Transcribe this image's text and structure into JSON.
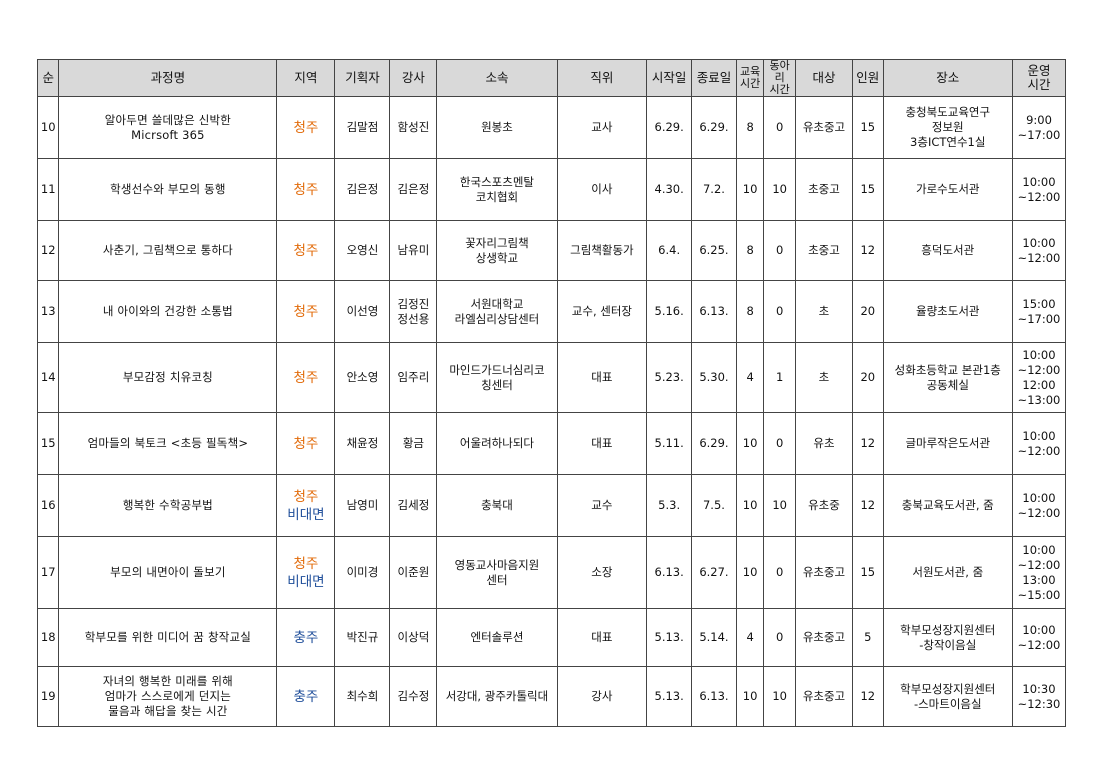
{
  "headers": {
    "no": "순",
    "course": "과정명",
    "region": "지역",
    "planner": "기획자",
    "instructor": "강사",
    "affiliation": "소속",
    "position": "직위",
    "start": "시작일",
    "end": "종료일",
    "edu_hours": "교육\n시간",
    "club_hours": "동아리\n시간",
    "target": "대상",
    "count": "인원",
    "place": "장소",
    "op_time": "운영\n시간"
  },
  "colors": {
    "cheongju": "#e26b0a",
    "online": "#1f4e9a",
    "chungju": "#1f4e9a",
    "header_bg": "#d9d9d9"
  },
  "rows": [
    {
      "no": "10",
      "course": [
        "알아두면 쓸데많은 신박한",
        "Micrsoft 365"
      ],
      "region": [
        "청주"
      ],
      "region_colors": [
        "orange"
      ],
      "planner": [
        "김말점"
      ],
      "instructor": [
        "함성진"
      ],
      "affiliation": [
        "원봉초"
      ],
      "position": [
        "교사"
      ],
      "start": "6.29.",
      "end": "6.29.",
      "edu": "8",
      "club": "0",
      "target": "유초중고",
      "count": "15",
      "place": [
        "충청북도교육연구",
        "정보원",
        "3층ICT연수1실"
      ],
      "time": [
        "9:00",
        "~17:00"
      ]
    },
    {
      "no": "11",
      "course": [
        "학생선수와 부모의 동행"
      ],
      "region": [
        "청주"
      ],
      "region_colors": [
        "orange"
      ],
      "planner": [
        "김은정"
      ],
      "instructor": [
        "김은정"
      ],
      "affiliation": [
        "한국스포츠멘탈",
        "코치협회"
      ],
      "position": [
        "이사"
      ],
      "start": "4.30.",
      "end": "7.2.",
      "edu": "10",
      "club": "10",
      "target": "초중고",
      "count": "15",
      "place": [
        "가로수도서관"
      ],
      "time": [
        "10:00",
        "~12:00"
      ]
    },
    {
      "no": "12",
      "course": [
        "사춘기, 그림책으로 통하다"
      ],
      "region": [
        "청주"
      ],
      "region_colors": [
        "orange"
      ],
      "planner": [
        "오영신"
      ],
      "instructor": [
        "남유미"
      ],
      "affiliation": [
        "꽃자리그림책",
        "상생학교"
      ],
      "position": [
        "그림책활동가"
      ],
      "start": "6.4.",
      "end": "6.25.",
      "edu": "8",
      "club": "0",
      "target": "초중고",
      "count": "12",
      "place": [
        "흥덕도서관"
      ],
      "time": [
        "10:00",
        "~12:00"
      ]
    },
    {
      "no": "13",
      "course": [
        "내 아이와의 건강한 소통법"
      ],
      "region": [
        "청주"
      ],
      "region_colors": [
        "orange"
      ],
      "planner": [
        "이선영"
      ],
      "instructor": [
        "김정진",
        "정선용"
      ],
      "affiliation": [
        "서원대학교",
        "라엘심리상담센터"
      ],
      "position": [
        "교수, 센터장"
      ],
      "start": "5.16.",
      "end": "6.13.",
      "edu": "8",
      "club": "0",
      "target": "초",
      "count": "20",
      "place": [
        "율량초도서관"
      ],
      "time": [
        "15:00",
        "~17:00"
      ]
    },
    {
      "no": "14",
      "course": [
        "부모감정 치유코칭"
      ],
      "region": [
        "청주"
      ],
      "region_colors": [
        "orange"
      ],
      "planner": [
        "안소영"
      ],
      "instructor": [
        "임주리"
      ],
      "affiliation": [
        "마인드가드너심리코",
        "칭센터"
      ],
      "position": [
        "대표"
      ],
      "start": "5.23.",
      "end": "5.30.",
      "edu": "4",
      "club": "1",
      "target": "초",
      "count": "20",
      "place": [
        "성화초등학교 본관1층",
        "공동체실"
      ],
      "time": [
        "10:00",
        "~12:00",
        "12:00",
        "~13:00"
      ]
    },
    {
      "no": "15",
      "course": [
        "엄마들의 북토크 <초등 필독책>"
      ],
      "region": [
        "청주"
      ],
      "region_colors": [
        "orange"
      ],
      "planner": [
        "채윤정"
      ],
      "instructor": [
        "황금"
      ],
      "affiliation": [
        "어울려하나되다"
      ],
      "position": [
        "대표"
      ],
      "start": "5.11.",
      "end": "6.29.",
      "edu": "10",
      "club": "0",
      "target": "유초",
      "count": "12",
      "place": [
        "글마루작은도서관"
      ],
      "time": [
        "10:00",
        "~12:00"
      ]
    },
    {
      "no": "16",
      "course": [
        "행복한 수학공부법"
      ],
      "region": [
        "청주",
        "비대면"
      ],
      "region_colors": [
        "orange",
        "blue"
      ],
      "planner": [
        "남영미"
      ],
      "instructor": [
        "김세정"
      ],
      "affiliation": [
        "충북대"
      ],
      "position": [
        "교수"
      ],
      "start": "5.3.",
      "end": "7.5.",
      "edu": "10",
      "club": "10",
      "target": "유초중",
      "count": "12",
      "place": [
        "충북교육도서관, 줌"
      ],
      "time": [
        "10:00",
        "~12:00"
      ]
    },
    {
      "no": "17",
      "course": [
        "부모의 내면아이 돌보기"
      ],
      "region": [
        "청주",
        "비대면"
      ],
      "region_colors": [
        "orange",
        "blue"
      ],
      "planner": [
        "이미경"
      ],
      "instructor": [
        "이준원"
      ],
      "affiliation": [
        "영동교사마음지원",
        "센터"
      ],
      "position": [
        "소장"
      ],
      "start": "6.13.",
      "end": "6.27.",
      "edu": "10",
      "club": "0",
      "target": "유초중고",
      "count": "15",
      "place": [
        "서원도서관, 줌"
      ],
      "time": [
        "10:00",
        "~12:00",
        "13:00",
        "~15:00"
      ]
    },
    {
      "no": "18",
      "course": [
        "학부모를 위한 미디어 꿈 창작교실"
      ],
      "region": [
        "충주"
      ],
      "region_colors": [
        "blue"
      ],
      "planner": [
        "박진규"
      ],
      "instructor": [
        "이상덕"
      ],
      "affiliation": [
        "엔터솔루션"
      ],
      "position": [
        "대표"
      ],
      "start": "5.13.",
      "end": "5.14.",
      "edu": "4",
      "club": "0",
      "target": "유초중고",
      "count": "5",
      "place": [
        "학부모성장지원센터",
        "-창작이음실"
      ],
      "time": [
        "10:00",
        "~12:00"
      ]
    },
    {
      "no": "19",
      "course": [
        "자녀의 행복한 미래를 위해",
        "엄마가 스스로에게 던지는",
        "물음과 해답을 찾는 시간"
      ],
      "region": [
        "충주"
      ],
      "region_colors": [
        "blue"
      ],
      "planner": [
        "최수희"
      ],
      "instructor": [
        "김수정"
      ],
      "affiliation": [
        "서강대, 광주카톨릭대"
      ],
      "position": [
        "강사"
      ],
      "start": "5.13.",
      "end": "6.13.",
      "edu": "10",
      "club": "10",
      "target": "유초중고",
      "count": "12",
      "place": [
        "학부모성장지원센터",
        "-스마트이음실"
      ],
      "time": [
        "10:30",
        "~12:30"
      ]
    }
  ]
}
